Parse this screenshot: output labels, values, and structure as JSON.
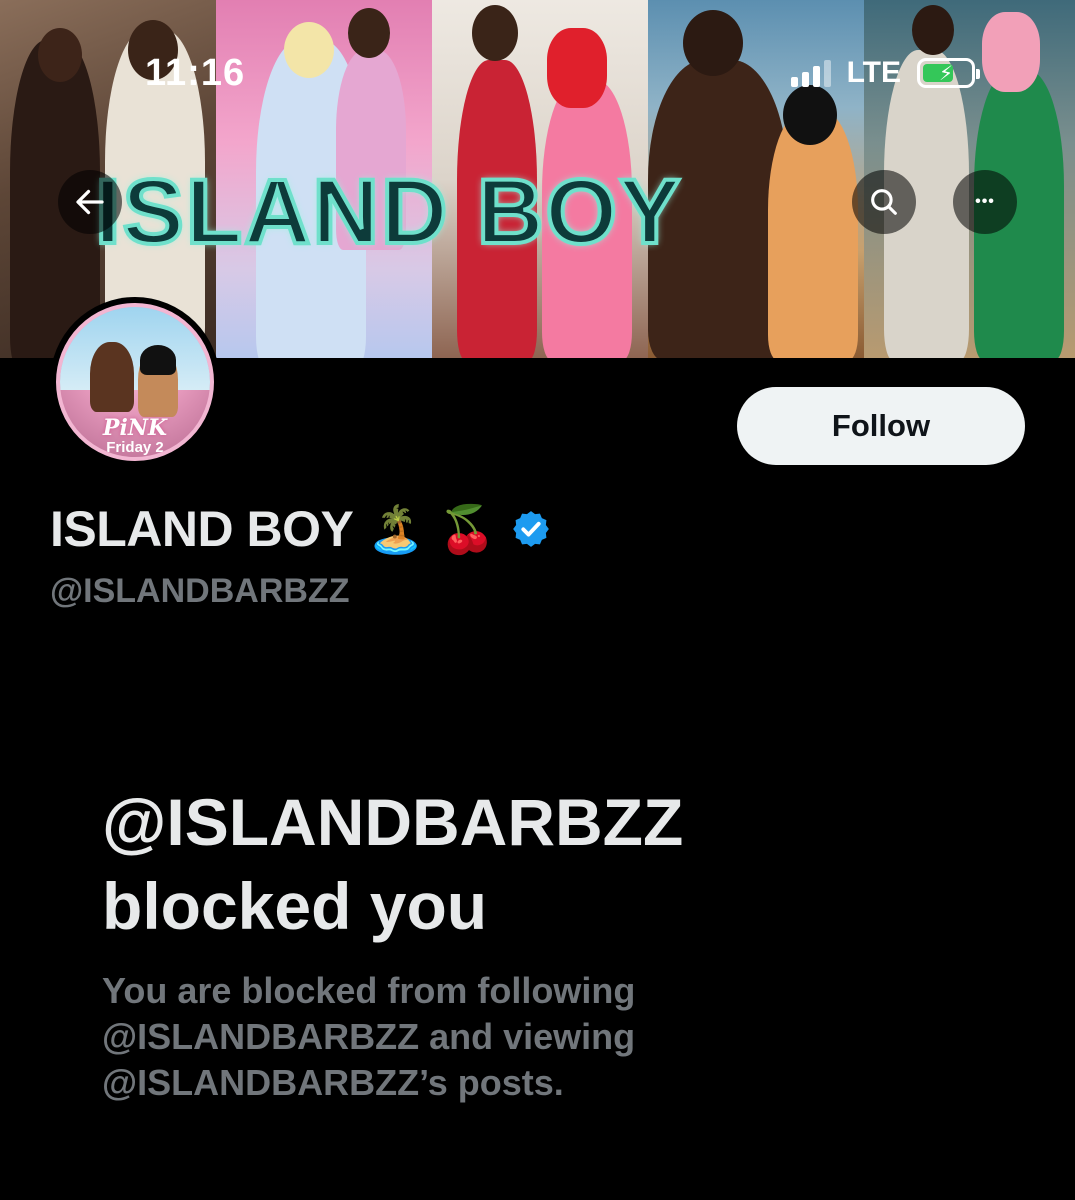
{
  "status_bar": {
    "time": "11:16",
    "network": "LTE",
    "battery_charging": true,
    "colors": {
      "battery_fill": "#34c759"
    }
  },
  "banner": {
    "title": "ISLAND BOY",
    "colors": {
      "title_outline": "#6fe0cb",
      "title_fill": "#0d3b3a"
    }
  },
  "nav": {
    "back_icon": "arrow-left-icon",
    "search_icon": "search-icon",
    "more_icon": "more-horizontal-icon",
    "more_glyph": "•••"
  },
  "avatar": {
    "line1": "PiNK",
    "line2": "Friday 2"
  },
  "actions": {
    "follow_label": "Follow"
  },
  "profile": {
    "display_name": "ISLAND BOY",
    "emoji1": "🏝️",
    "emoji2": "🍒",
    "verified": true,
    "handle": "@ISLANDBARBZZ",
    "colors": {
      "verified": "#1d9bf0",
      "muted_text": "#71767b"
    }
  },
  "blocked": {
    "title_line1": "@ISLANDBARBZZ",
    "title_line2": "blocked you",
    "description": "You are blocked from following @ISLANDBARBZZ and viewing @ISLANDBARBZZ’s posts."
  }
}
